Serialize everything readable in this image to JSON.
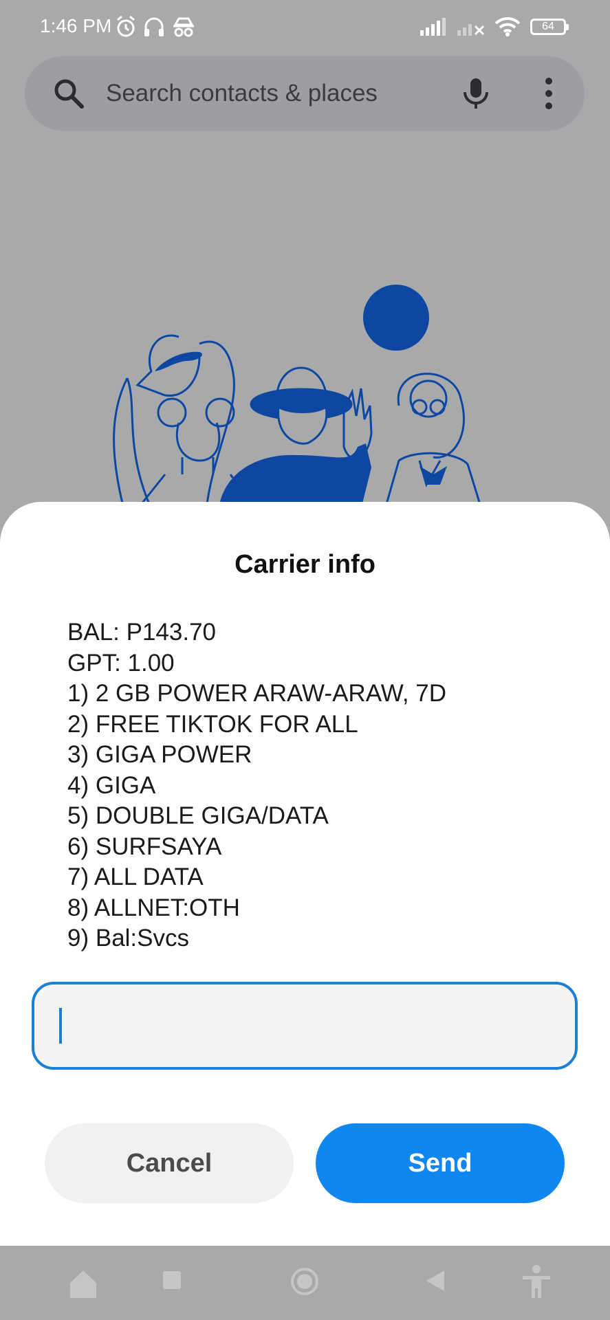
{
  "status_bar": {
    "time": "1:46 PM",
    "left_icons": [
      "alarm-icon",
      "headphones-icon",
      "incognito-icon"
    ],
    "right_icons": [
      "signal-strength-icon",
      "no-signal-icon",
      "wifi-icon"
    ],
    "battery_level": "64"
  },
  "search": {
    "placeholder": "Search contacts & places",
    "icons": [
      "search-icon",
      "mic-icon",
      "more-vert-icon"
    ]
  },
  "colors": {
    "accent": "#0f86f0",
    "illustration": "#0d47a1",
    "scrim": "#a8a9ab"
  },
  "dialog": {
    "title": "Carrier info",
    "lines": [
      "BAL: P143.70",
      "GPT: 1.00",
      "1) 2 GB POWER ARAW-ARAW, 7D",
      "2) FREE TIKTOK FOR ALL",
      "3) GIGA POWER",
      "4) GIGA",
      "5) DOUBLE GIGA/DATA",
      "6) SURFSAYA",
      "7) ALL DATA",
      "8) ALLNET:OTH",
      "9) Bal:Svcs"
    ],
    "input_value": "",
    "cancel_label": "Cancel",
    "send_label": "Send"
  },
  "nav_bar": {
    "icons": [
      "home-icon",
      "recents-icon",
      "circle-home-icon",
      "back-icon",
      "accessibility-icon"
    ]
  }
}
